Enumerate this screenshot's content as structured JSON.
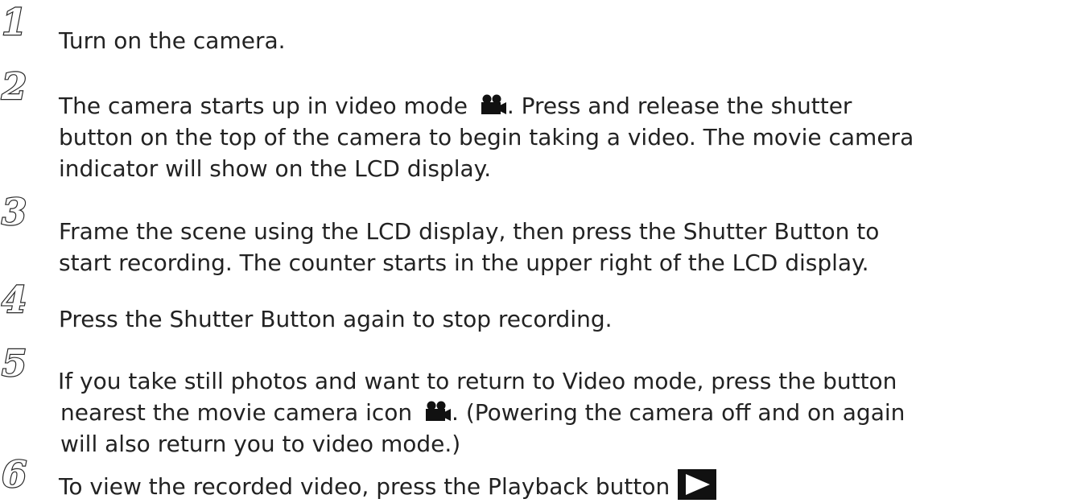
{
  "steps": [
    {
      "num_icon": "step-1-icon",
      "lines": [
        "Turn on the camera."
      ]
    },
    {
      "num_icon": "step-2-icon",
      "lines": [
        "The camera starts up in video mode ",
        ". Press and release the shutter",
        "button on the top of the camera to begin taking a video. The movie camera",
        "indicator will show on the LCD display."
      ]
    },
    {
      "num_icon": "step-3-icon",
      "lines": [
        "Frame the scene using the LCD display, then press the Shutter Button to",
        "start recording. The counter starts in the upper right of the LCD display."
      ]
    },
    {
      "num_icon": "step-4-icon",
      "lines": [
        "Press the Shutter Button again to stop recording."
      ]
    },
    {
      "num_icon": "step-5-icon",
      "lines": [
        "If you take still photos and want to return to Video mode, press the button",
        "nearest the movie camera icon ",
        ". (Powering the camera off and on again",
        "will also return you to video mode.)"
      ]
    },
    {
      "num_icon": "step-6-icon",
      "lines": [
        "To view the recorded video, press the Playback button"
      ]
    }
  ],
  "icons": {
    "movie_camera": "movie-camera-icon",
    "playback": "playback-button-icon"
  }
}
